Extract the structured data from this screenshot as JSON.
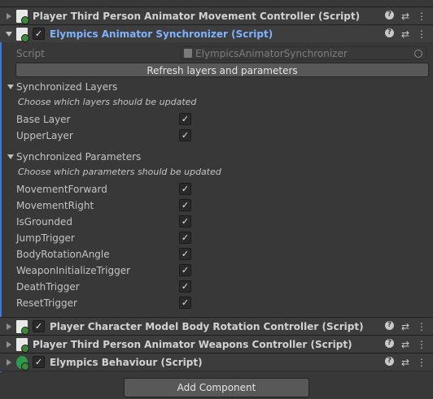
{
  "components": [
    {
      "title": "Player Third Person Animator Movement Controller (Script)",
      "has_checkbox": false,
      "expanded": false
    },
    {
      "title": "Elympics Animator Synchronizer (Script)",
      "has_checkbox": true,
      "expanded": true
    },
    {
      "title": "Player Character Model Body Rotation Controller (Script)",
      "has_checkbox": true,
      "expanded": false
    },
    {
      "title": "Player Third Person Animator Weapons Controller (Script)",
      "has_checkbox": false,
      "expanded": false
    },
    {
      "title": "Elympics Behaviour (Script)",
      "has_checkbox": true,
      "expanded": false
    }
  ],
  "synchronizer": {
    "script_label": "Script",
    "script_value": "ElympicsAnimatorSynchronizer",
    "refresh_button": "Refresh layers and parameters",
    "layers_title": "Synchronized Layers",
    "layers_hint": "Choose which layers should be updated",
    "layers": [
      {
        "name": "Base Layer",
        "checked": true
      },
      {
        "name": "UpperLayer",
        "checked": true
      }
    ],
    "params_title": "Synchronized Parameters",
    "params_hint": "Choose which parameters should be updated",
    "params": [
      {
        "name": "MovementForward",
        "checked": true
      },
      {
        "name": "MovementRight",
        "checked": true
      },
      {
        "name": "IsGrounded",
        "checked": true
      },
      {
        "name": "JumpTrigger",
        "checked": true
      },
      {
        "name": "BodyRotationAngle",
        "checked": true
      },
      {
        "name": "WeaponInitializeTrigger",
        "checked": true
      },
      {
        "name": "DeathTrigger",
        "checked": true
      },
      {
        "name": "ResetTrigger",
        "checked": true
      }
    ]
  },
  "add_component_label": "Add Component",
  "icons": {
    "help": "help-icon",
    "settings": "preset-sliders-icon",
    "menu": "kebab-menu-icon",
    "check": "✓"
  }
}
